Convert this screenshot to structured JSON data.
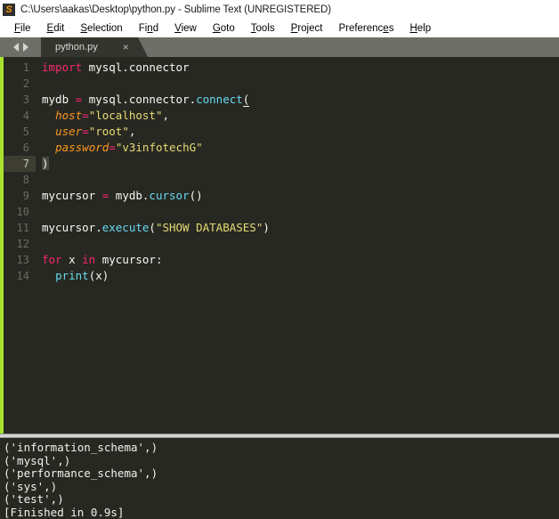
{
  "window": {
    "logo_icon": "sublime-text-logo-icon",
    "logo_letter": "S",
    "title": "C:\\Users\\aakas\\Desktop\\python.py - Sublime Text (UNREGISTERED)",
    "titlebar_bg": "#ffffff",
    "title_color": "#1b1b1b"
  },
  "menubar": {
    "items": [
      {
        "label": "File",
        "mnemonic_index": 0
      },
      {
        "label": "Edit",
        "mnemonic_index": 0
      },
      {
        "label": "Selection",
        "mnemonic_index": 0
      },
      {
        "label": "Find",
        "mnemonic_index": 2
      },
      {
        "label": "View",
        "mnemonic_index": 0
      },
      {
        "label": "Goto",
        "mnemonic_index": 0
      },
      {
        "label": "Tools",
        "mnemonic_index": 0
      },
      {
        "label": "Project",
        "mnemonic_index": 0
      },
      {
        "label": "Preferences",
        "mnemonic_index": 9
      },
      {
        "label": "Help",
        "mnemonic_index": 0
      }
    ]
  },
  "tabbar": {
    "nav_prev_icon": "arrow-left-icon",
    "nav_next_icon": "arrow-right-icon",
    "tabs": [
      {
        "label": "python.py",
        "close_icon": "close-icon",
        "close_glyph": "×",
        "active": true
      }
    ],
    "bg": "#6e6f68",
    "active_tab_bg": "#34352f"
  },
  "editor": {
    "theme": "Monokai",
    "background": "#272822",
    "left_stripe_color": "#a6e22e",
    "active_line": 7,
    "gutter_active_bg": "#3e3d32",
    "colors": {
      "keyword": "#f92672",
      "function": "#66d9ef",
      "string": "#e6db74",
      "parameter": "#fd971f",
      "plain": "#f8f8f2",
      "line_number": "#6a6b62",
      "line_number_active": "#c6c7c0"
    },
    "line_numbers": [
      1,
      2,
      3,
      4,
      5,
      6,
      7,
      8,
      9,
      10,
      11,
      12,
      13,
      14
    ],
    "lines": [
      {
        "n": 1,
        "tokens": [
          {
            "t": "import",
            "c": "kw"
          },
          {
            "t": " mysql.connector",
            "c": "plain"
          }
        ]
      },
      {
        "n": 2,
        "tokens": []
      },
      {
        "n": 3,
        "tokens": [
          {
            "t": "mydb ",
            "c": "plain"
          },
          {
            "t": "=",
            "c": "kw"
          },
          {
            "t": " mysql.connector.",
            "c": "plain"
          },
          {
            "t": "connect",
            "c": "fn"
          },
          {
            "t": "(",
            "c": "caret"
          }
        ]
      },
      {
        "n": 4,
        "tokens": [
          {
            "t": "  ",
            "c": "plain"
          },
          {
            "t": "host",
            "c": "param"
          },
          {
            "t": "=",
            "c": "kw"
          },
          {
            "t": "\"localhost\"",
            "c": "str"
          },
          {
            "t": ",",
            "c": "plain"
          }
        ]
      },
      {
        "n": 5,
        "tokens": [
          {
            "t": "  ",
            "c": "plain"
          },
          {
            "t": "user",
            "c": "param"
          },
          {
            "t": "=",
            "c": "kw"
          },
          {
            "t": "\"root\"",
            "c": "str"
          },
          {
            "t": ",",
            "c": "plain"
          }
        ]
      },
      {
        "n": 6,
        "tokens": [
          {
            "t": "  ",
            "c": "plain"
          },
          {
            "t": "password",
            "c": "param"
          },
          {
            "t": "=",
            "c": "kw"
          },
          {
            "t": "\"v3infotechG\"",
            "c": "str"
          }
        ]
      },
      {
        "n": 7,
        "tokens": [
          {
            "t": ")",
            "c": "bracket"
          }
        ]
      },
      {
        "n": 8,
        "tokens": []
      },
      {
        "n": 9,
        "tokens": [
          {
            "t": "mycursor ",
            "c": "plain"
          },
          {
            "t": "=",
            "c": "kw"
          },
          {
            "t": " mydb.",
            "c": "plain"
          },
          {
            "t": "cursor",
            "c": "fn"
          },
          {
            "t": "()",
            "c": "plain"
          }
        ]
      },
      {
        "n": 10,
        "tokens": []
      },
      {
        "n": 11,
        "tokens": [
          {
            "t": "mycursor.",
            "c": "plain"
          },
          {
            "t": "execute",
            "c": "fn"
          },
          {
            "t": "(",
            "c": "plain"
          },
          {
            "t": "\"SHOW DATABASES\"",
            "c": "str"
          },
          {
            "t": ")",
            "c": "plain"
          }
        ]
      },
      {
        "n": 12,
        "tokens": []
      },
      {
        "n": 13,
        "tokens": [
          {
            "t": "for",
            "c": "kw"
          },
          {
            "t": " x ",
            "c": "plain"
          },
          {
            "t": "in",
            "c": "kw"
          },
          {
            "t": " mycursor:",
            "c": "plain"
          }
        ]
      },
      {
        "n": 14,
        "tokens": [
          {
            "t": "  ",
            "c": "plain"
          },
          {
            "t": "print",
            "c": "fn"
          },
          {
            "t": "(x)",
            "c": "plain"
          }
        ]
      }
    ]
  },
  "output_panel": {
    "background": "#272822",
    "text_color": "#f2f2ec",
    "lines": [
      "('information_schema',)",
      "('mysql',)",
      "('performance_schema',)",
      "('sys',)",
      "('test',)",
      "[Finished in 0.9s]"
    ],
    "build_time": "0.9s",
    "build_status": "Finished"
  }
}
